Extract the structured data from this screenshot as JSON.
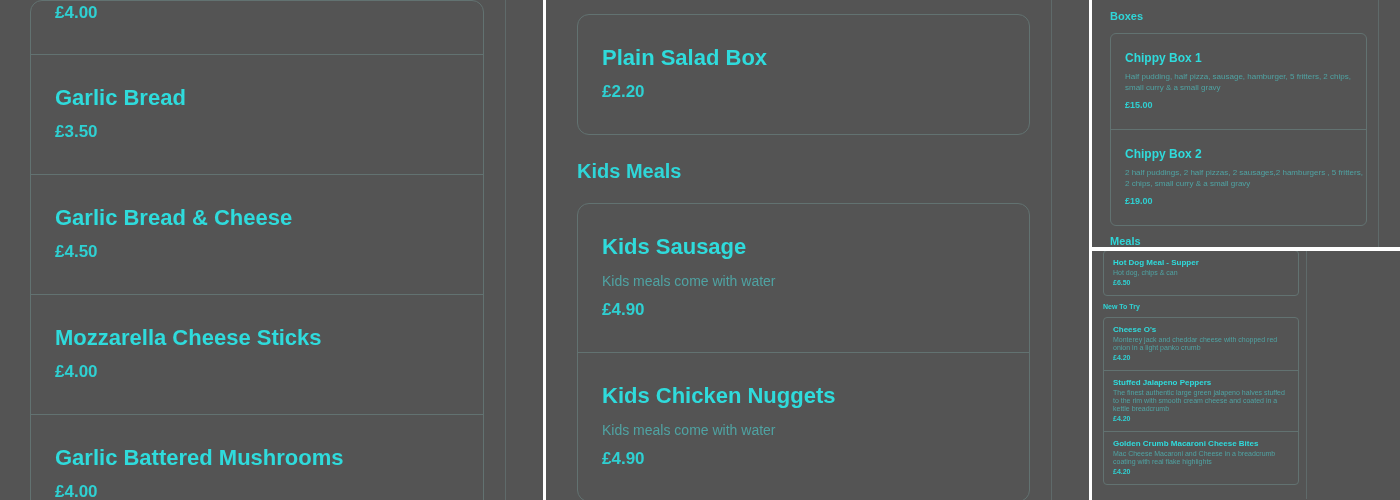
{
  "panels": [
    {
      "kind": "left",
      "sections": [
        {
          "items": [
            {
              "price": "£4.00"
            },
            {
              "title": "Garlic Bread",
              "price": "£3.50"
            },
            {
              "title": "Garlic Bread & Cheese",
              "price": "£4.50"
            },
            {
              "title": "Mozzarella Cheese Sticks",
              "price": "£4.00"
            },
            {
              "title": "Garlic Battered Mushrooms",
              "price": "£4.00"
            }
          ]
        }
      ]
    },
    {
      "kind": "middle",
      "sections": [
        {
          "items": [
            {
              "title": "Plain Salad Box",
              "price": "£2.20"
            }
          ]
        },
        {
          "heading": "Kids Meals",
          "items": [
            {
              "title": "Kids Sausage",
              "description": "Kids meals come with water",
              "price": "£4.90"
            },
            {
              "title": "Kids Chicken Nuggets",
              "description": "Kids meals come with water",
              "price": "£4.90"
            }
          ]
        }
      ]
    },
    {
      "kind": "small",
      "sections": [
        {
          "heading": "Boxes",
          "items": [
            {
              "title": "Chippy Box 1",
              "description": "Half pudding, half pizza, sausage, hamburger, 5 fritters, 2 chips, small curry & a small gravy",
              "price": "£15.00"
            },
            {
              "title": "Chippy Box 2",
              "description": "2 half puddings, 2 half pizzas, 2 sausages,2 hamburgers , 5 fritters, 2 chips, small curry & a small gravy",
              "price": "£19.00"
            }
          ]
        },
        {
          "heading": "Meals"
        }
      ]
    },
    {
      "kind": "tiny",
      "sections": [
        {
          "items": [
            {
              "title": "Hot Dog Meal - Supper",
              "description": "Hot dog, chips & can",
              "price": "£6.50"
            }
          ]
        },
        {
          "heading": "New To Try",
          "items": [
            {
              "title": "Cheese O's",
              "description": "Monterey jack and cheddar cheese with chopped red onion in a light panko crumb",
              "price": "£4.20"
            },
            {
              "title": "Stuffed Jalapeno Peppers",
              "description": "The finest authentic large green jalapeno halves stuffed to the rim with smooth cream cheese and coated in a kettle breadcrumb",
              "price": "£4.20"
            },
            {
              "title": "Golden Crumb Macaroni Cheese Bites",
              "description": "Mac Cheese Macaroni and Cheese in a breadcrumb coating with real flake highlights",
              "price": "£4.20"
            }
          ]
        }
      ]
    }
  ]
}
